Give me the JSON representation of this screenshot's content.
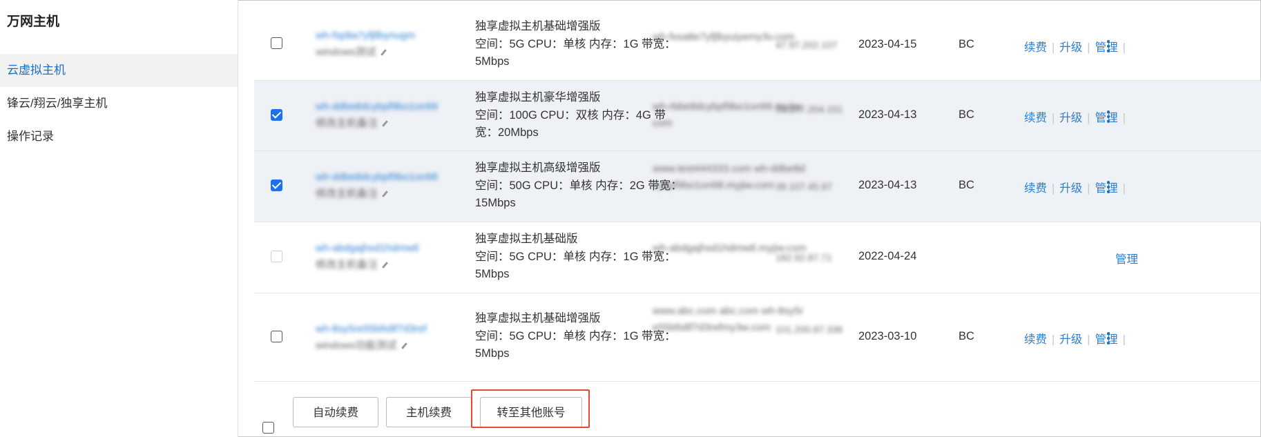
{
  "sidebar": {
    "title": "万网主机",
    "items": [
      {
        "label": "云虚拟主机",
        "active": true
      },
      {
        "label": "锋云/翔云/独享主机",
        "active": false
      },
      {
        "label": "操作记录",
        "active": false
      }
    ]
  },
  "rows": [
    {
      "checked": false,
      "disabled": false,
      "name": "wh-fsp8a7yfjllbynugm",
      "note": "windows测试",
      "spec_title": "独享虚拟主机基础增强版",
      "spec_detail": "空间：5G CPU：单核 内存：1G 带宽：5Mbps",
      "domain": "wh-fxsa8e7yfjlbyuiyemy3v.com",
      "ip": "47.97.202.107",
      "date": "2023-04-15",
      "type": "BC",
      "ops": [
        "续费",
        "升级",
        "管理"
      ]
    },
    {
      "checked": true,
      "disabled": false,
      "name": "wh-ddbe8dcybpf9bo1on99",
      "note": "修改主机备注",
      "spec_title": "独享虚拟主机豪华增强版",
      "spec_detail": "空间：100G CPU：双核 内存：4G 带宽：20Mbps",
      "domain": "wh-rbbe8dcybpf9bo1on99.myjiw.com",
      "ip": "39.107.204.151",
      "date": "2023-04-13",
      "type": "BC",
      "ops": [
        "续费",
        "升级",
        "管理"
      ]
    },
    {
      "checked": true,
      "disabled": false,
      "name": "wh-ddbe8dcybpf9bo1on98",
      "note": "修改主机备注",
      "spec_title": "独享虚拟主机高级增强版",
      "spec_detail": "空间：50G CPU：单核 内存：2G 带宽：15Mbps",
      "domain": "www.test444333.com wh-ddbe8dcybpf9bo1on98.myjiw.com",
      "ip": "39.107.45.97",
      "date": "2023-04-13",
      "type": "BC",
      "ops": [
        "续费",
        "升级",
        "管理"
      ]
    },
    {
      "checked": false,
      "disabled": true,
      "name": "wh-abdgajhsd1hdmwtl",
      "note": "修改主机备注",
      "spec_title": "独享虚拟主机基础版",
      "spec_detail": "空间：5G CPU：单核 内存：1G 带宽：5Mbps",
      "domain": "wh-abdgajhsd1hdmwtl.myjiw.com",
      "ip": "182.92.87.71",
      "date": "2022-04-24",
      "type": "",
      "ops": [
        "管理"
      ]
    },
    {
      "checked": false,
      "disabled": false,
      "name": "wh-8sy5re55bfs8f7d3ref",
      "note": "windows功能测试",
      "spec_title": "独享虚拟主机基础增强版",
      "spec_detail": "空间：5G CPU：单核 内存：1G 带宽：5Mbps",
      "domain": "www.abc.com abc.com wh-8sy5re55bfs8f7d3refmy3w.com",
      "ip": "101.200.87.336",
      "date": "2023-03-10",
      "type": "BC",
      "ops": [
        "续费",
        "升级",
        "管理"
      ]
    }
  ],
  "footer": {
    "buttons": [
      "自动续费",
      "主机续费",
      "转至其他账号"
    ]
  }
}
